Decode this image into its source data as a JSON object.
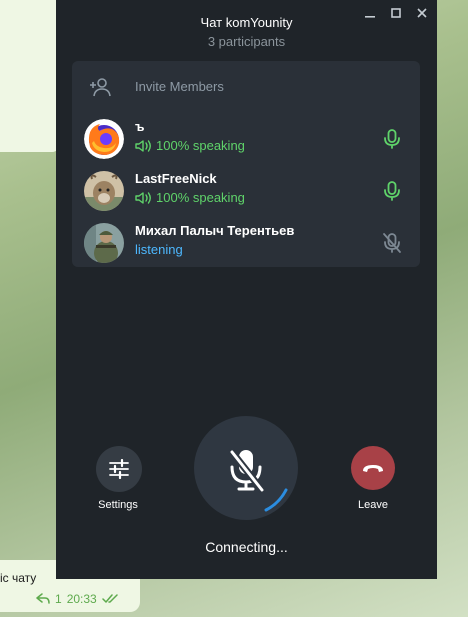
{
  "background": {
    "message_text": "іс чату",
    "reply_count": "1",
    "time": "20:33"
  },
  "window": {
    "title": "Чат komYounity",
    "subtitle": "3 participants",
    "controls": [
      "minimize-icon",
      "maximize-icon",
      "close-icon"
    ]
  },
  "invite": {
    "label": "Invite Members",
    "icon": "add-user-icon"
  },
  "participants": [
    {
      "name": "ъ",
      "status": "100% speaking",
      "state": "speaking",
      "avatar": "firefox-logo",
      "mic": "mic-active-icon"
    },
    {
      "name": "LastFreeNick",
      "status": "100% speaking",
      "state": "speaking",
      "avatar": "animal-photo",
      "mic": "mic-active-icon"
    },
    {
      "name": "Михал Палыч Терентьев",
      "status": "listening",
      "state": "listening",
      "avatar": "soldier-photo",
      "mic": "mic-muted-icon"
    }
  ],
  "controls": {
    "settings_label": "Settings",
    "leave_label": "Leave",
    "status_text": "Connecting..."
  },
  "colors": {
    "window_bg": "#1f2429",
    "panel_bg": "#2a3038",
    "speaking": "#5fd36a",
    "listening": "#4db8ff",
    "leave": "#a84147",
    "accent_ring": "#2b8de0"
  }
}
